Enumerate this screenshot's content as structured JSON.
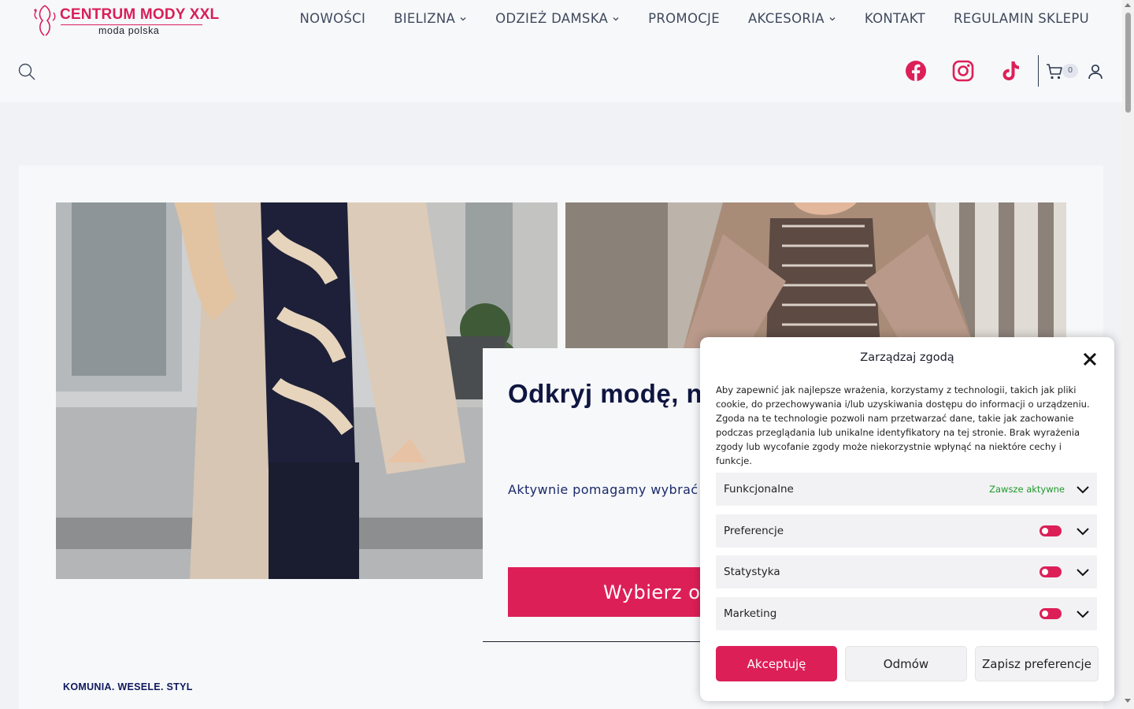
{
  "header": {
    "logo_title": "CENTRUM MODY XXL",
    "logo_subtitle": "moda  polska"
  },
  "nav": {
    "items": [
      {
        "label": "NOWOŚCI",
        "dropdown": false
      },
      {
        "label": "BIELIZNA",
        "dropdown": true
      },
      {
        "label": "ODZIEŻ DAMSKA",
        "dropdown": true
      },
      {
        "label": "PROMOCJE",
        "dropdown": false
      },
      {
        "label": "AKCESORIA",
        "dropdown": true
      },
      {
        "label": "KONTAKT",
        "dropdown": false
      },
      {
        "label": "REGULAMIN SKLEPU",
        "dropdown": false
      }
    ]
  },
  "toolbar": {
    "cart_count": "0",
    "icons": [
      "search-icon",
      "facebook-icon",
      "instagram-icon",
      "tiktok-icon",
      "cart-icon",
      "account-icon"
    ],
    "social_color": "#dd1f58"
  },
  "hero": {
    "title": "Odkryj modę, na Twoim kon",
    "text": "Aktywnie pomagamy wybrać s Ciebie.",
    "button": "Wybierz o",
    "tagline": "KOMUNIA. WESELE. STYL"
  },
  "consent": {
    "title": "Zarządzaj zgodą",
    "body": "Aby zapewnić jak najlepsze wrażenia, korzystamy z technologii, takich jak pliki cookie, do przechowywania i/lub uzyskiwania dostępu do informacji o urządzeniu. Zgoda na te technologie pozwoli nam przetwarzać dane, takie jak zachowanie podczas przeglądania lub unikalne identyfikatory na tej stronie. Brak wyrażenia zgody lub wycofanie zgody może niekorzystnie wpłynąć na niektóre cechy i funkcje.",
    "categories": [
      {
        "label": "Funkcjonalne",
        "status": "Zawsze aktywne"
      },
      {
        "label": "Preferencje"
      },
      {
        "label": "Statystyka"
      },
      {
        "label": "Marketing"
      }
    ],
    "accept": "Akceptuję",
    "deny": "Odmów",
    "save": "Zapisz preferencje"
  },
  "colors": {
    "accent": "#dd1f58",
    "navy": "#0f1640",
    "always_active": "#1e9a2a"
  }
}
